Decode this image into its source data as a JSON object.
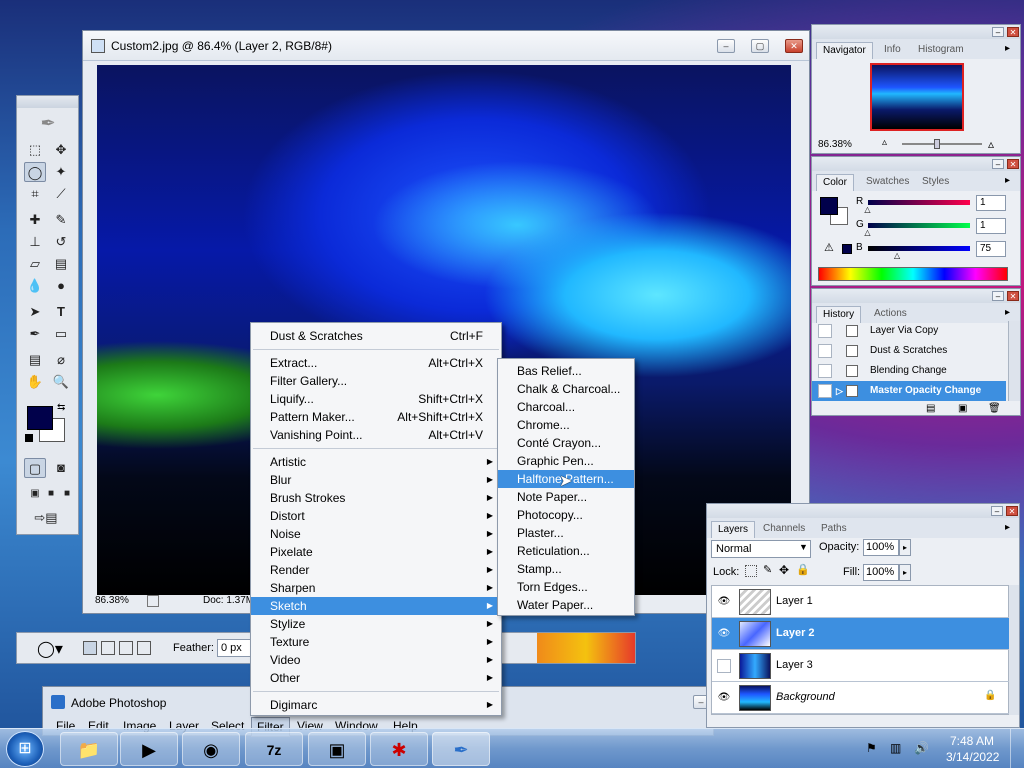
{
  "document": {
    "title": "Custom2.jpg @ 86.4% (Layer 2, RGB/8#)",
    "zoom": "86.38%",
    "doc_info": "Doc: 1.37M"
  },
  "filter_menu": {
    "items": [
      {
        "label": "Dust & Scratches",
        "shortcut": "Ctrl+F"
      },
      {
        "label": "Extract...",
        "shortcut": "Alt+Ctrl+X"
      },
      {
        "label": "Filter Gallery...",
        "shortcut": ""
      },
      {
        "label": "Liquify...",
        "shortcut": "Shift+Ctrl+X"
      },
      {
        "label": "Pattern Maker...",
        "shortcut": "Alt+Shift+Ctrl+X"
      },
      {
        "label": "Vanishing Point...",
        "shortcut": "Alt+Ctrl+V"
      },
      {
        "label": "Artistic"
      },
      {
        "label": "Blur"
      },
      {
        "label": "Brush Strokes"
      },
      {
        "label": "Distort"
      },
      {
        "label": "Noise"
      },
      {
        "label": "Pixelate"
      },
      {
        "label": "Render"
      },
      {
        "label": "Sharpen"
      },
      {
        "label": "Sketch"
      },
      {
        "label": "Stylize"
      },
      {
        "label": "Texture"
      },
      {
        "label": "Video"
      },
      {
        "label": "Other"
      },
      {
        "label": "Digimarc"
      }
    ]
  },
  "sketch_menu": {
    "items": [
      "Bas Relief...",
      "Chalk & Charcoal...",
      "Charcoal...",
      "Chrome...",
      "Conté Crayon...",
      "Graphic Pen...",
      "Halftone Pattern...",
      "Note Paper...",
      "Photocopy...",
      "Plaster...",
      "Reticulation...",
      "Stamp...",
      "Torn Edges...",
      "Water Paper..."
    ]
  },
  "navigator": {
    "tabs": [
      "Navigator",
      "Info",
      "Histogram"
    ],
    "zoom": "86.38%"
  },
  "color_panel": {
    "tabs": [
      "Color",
      "Swatches",
      "Styles"
    ],
    "r_label": "R",
    "g_label": "G",
    "b_label": "B",
    "r": "1",
    "g": "1",
    "b": "75",
    "r_level": 0.004,
    "g_level": 0.004,
    "b_level": 0.294,
    "foreground": "#01014b"
  },
  "history_panel": {
    "tabs": [
      "History",
      "Actions"
    ],
    "items": [
      "Layer Via Copy",
      "Dust & Scratches",
      "Blending Change",
      "Master Opacity Change"
    ]
  },
  "layers_panel": {
    "tabs": [
      "Layers",
      "Channels",
      "Paths"
    ],
    "blend_mode": "Normal",
    "opacity_label": "Opacity:",
    "opacity": "100%",
    "lock_label": "Lock:",
    "fill_label": "Fill:",
    "fill": "100%",
    "layers": [
      "Layer 1",
      "Layer 2",
      "Layer 3",
      "Background"
    ]
  },
  "options_bar": {
    "feather_label": "Feather:",
    "feather_value": "0 px"
  },
  "main_window": {
    "title": "Adobe Photoshop",
    "menu": [
      "File",
      "Edit",
      "Image",
      "Layer",
      "Select",
      "Filter",
      "View",
      "Window",
      "Help"
    ]
  },
  "taskbar": {
    "time": "7:48 AM",
    "date": "3/14/2022"
  }
}
